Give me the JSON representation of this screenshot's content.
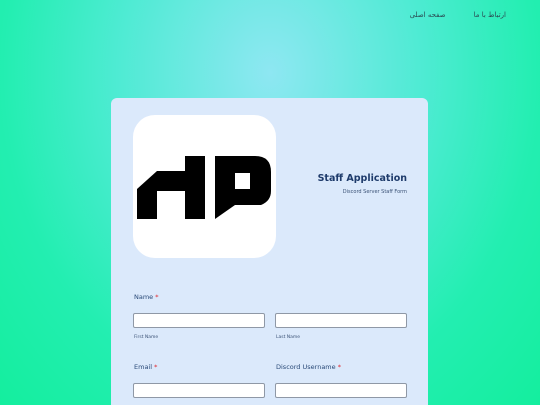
{
  "nav": {
    "links": [
      "صفحه اصلی",
      "ارتباط با ما"
    ]
  },
  "logo": {
    "text": "HP"
  },
  "form": {
    "title": "Staff Application",
    "subtitle": "Discord Server Staff Form",
    "required_mark": "*",
    "name": {
      "label": "Name",
      "first_value": "",
      "first_sublabel": "First Name",
      "last_value": "",
      "last_sublabel": "Last Name"
    },
    "email": {
      "label": "Email",
      "value": ""
    },
    "discord": {
      "label": "Discord Username",
      "value": ""
    }
  },
  "colors": {
    "card_bg": "#dbe9fb",
    "title": "#1e3b6b",
    "required": "#e0262b",
    "bg_gradient": [
      "#8ee7f2",
      "#14ee9e"
    ]
  }
}
